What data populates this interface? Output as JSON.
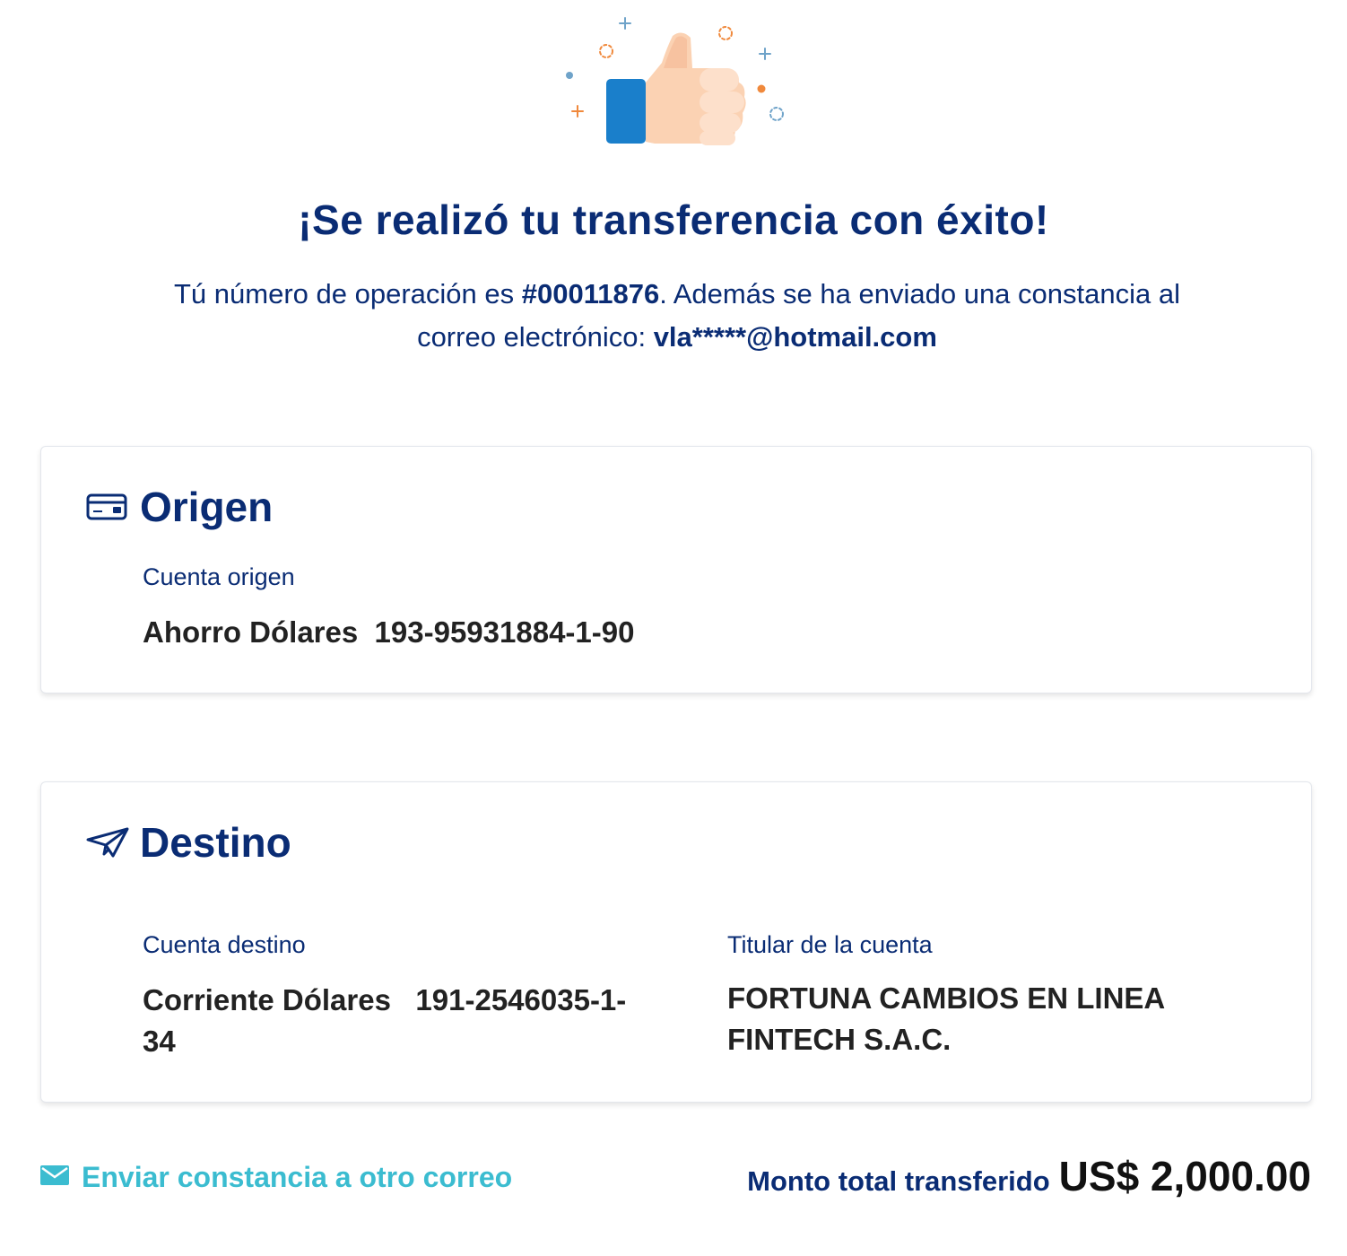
{
  "success": {
    "title": "¡Se realizó tu transferencia con éxito!",
    "msg_prefix": "Tú número de operación es ",
    "operation_number": "#00011876",
    "msg_middle": ". Además se ha enviado una constancia al correo electrónico: ",
    "email": "vla*****@hotmail.com"
  },
  "origen": {
    "heading": "Origen",
    "icon": "card-icon",
    "label": "Cuenta origen",
    "account": "Ahorro Dólares  193-95931884-1-90"
  },
  "destino": {
    "heading": "Destino",
    "icon": "paper-plane-icon",
    "account_label": "Cuenta destino",
    "account_line1": "Corriente Dólares   191-2546035-1-",
    "account_line2": "34",
    "holder_label": "Titular de la cuenta",
    "holder_line1": "FORTUNA CAMBIOS EN LINEA",
    "holder_line2": "FINTECH S.A.C."
  },
  "footer": {
    "send_link": "Enviar constancia a otro correo",
    "total_label": "Monto total transferido",
    "total_amount": "US$ 2,000.00"
  },
  "colors": {
    "primary": "#0a2c74",
    "link": "#3bbcd0",
    "thumb_blue": "#1a7fcb",
    "thumb_skin": "#fbd2b3",
    "accent_orange": "#f0893c"
  }
}
